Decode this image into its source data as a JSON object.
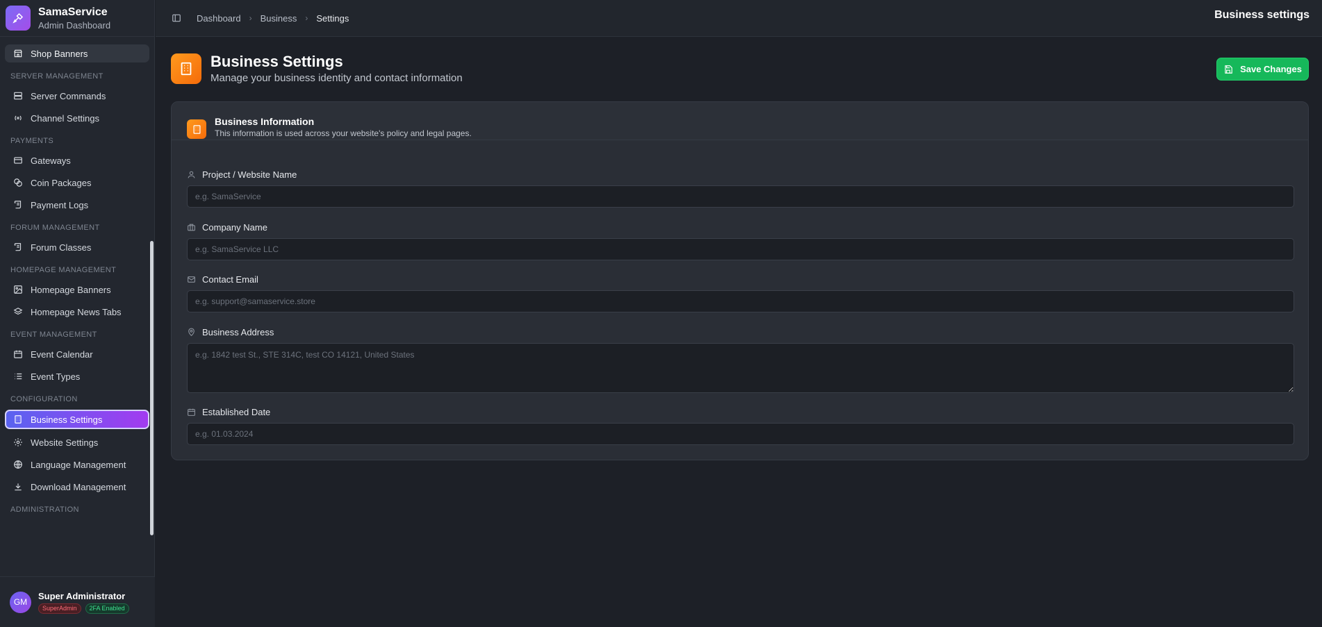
{
  "brand": {
    "title": "SamaService",
    "subtitle": "Admin Dashboard"
  },
  "sidebar": {
    "top_item": "Shop Banners",
    "sections": {
      "server": "SERVER MANAGEMENT",
      "payments": "PAYMENTS",
      "forum": "FORUM MANAGEMENT",
      "homepage": "HOMEPAGE MANAGEMENT",
      "event": "EVENT MANAGEMENT",
      "config": "CONFIGURATION",
      "admin": "ADMINISTRATION"
    },
    "items": {
      "server_commands": "Server Commands",
      "channel_settings": "Channel Settings",
      "gateways": "Gateways",
      "coin_packages": "Coin Packages",
      "payment_logs": "Payment Logs",
      "forum_classes": "Forum Classes",
      "homepage_banners": "Homepage Banners",
      "homepage_news_tabs": "Homepage News Tabs",
      "event_calendar": "Event Calendar",
      "event_types": "Event Types",
      "business_settings": "Business Settings",
      "website_settings": "Website Settings",
      "language_management": "Language Management",
      "download_management": "Download Management"
    }
  },
  "user": {
    "initials": "GM",
    "name": "Super Administrator",
    "role_badge": "SuperAdmin",
    "twofa_badge": "2FA Enabled"
  },
  "topbar": {
    "breadcrumbs": [
      "Dashboard",
      "Business",
      "Settings"
    ],
    "title": "Business settings"
  },
  "page": {
    "title": "Business Settings",
    "subtitle": "Manage your business identity and contact information",
    "save_label": "Save Changes"
  },
  "card": {
    "title": "Business Information",
    "subtitle": "This information is used across your website's policy and legal pages."
  },
  "fields": {
    "project_name": {
      "label": "Project / Website Name",
      "placeholder": "e.g. SamaService",
      "value": ""
    },
    "company_name": {
      "label": "Company Name",
      "placeholder": "e.g. SamaService LLC",
      "value": ""
    },
    "contact_email": {
      "label": "Contact Email",
      "placeholder": "e.g. support@samaservice.store",
      "value": ""
    },
    "business_address": {
      "label": "Business Address",
      "placeholder": "e.g. 1842 test St., STE 314C, test CO 14121, United States",
      "value": ""
    },
    "established_date": {
      "label": "Established Date",
      "placeholder": "e.g. 01.03.2024",
      "value": ""
    }
  },
  "colors": {
    "accent_purple": "#8b5cf6",
    "accent_orange": "#f97316",
    "save_green": "#16b85a"
  }
}
